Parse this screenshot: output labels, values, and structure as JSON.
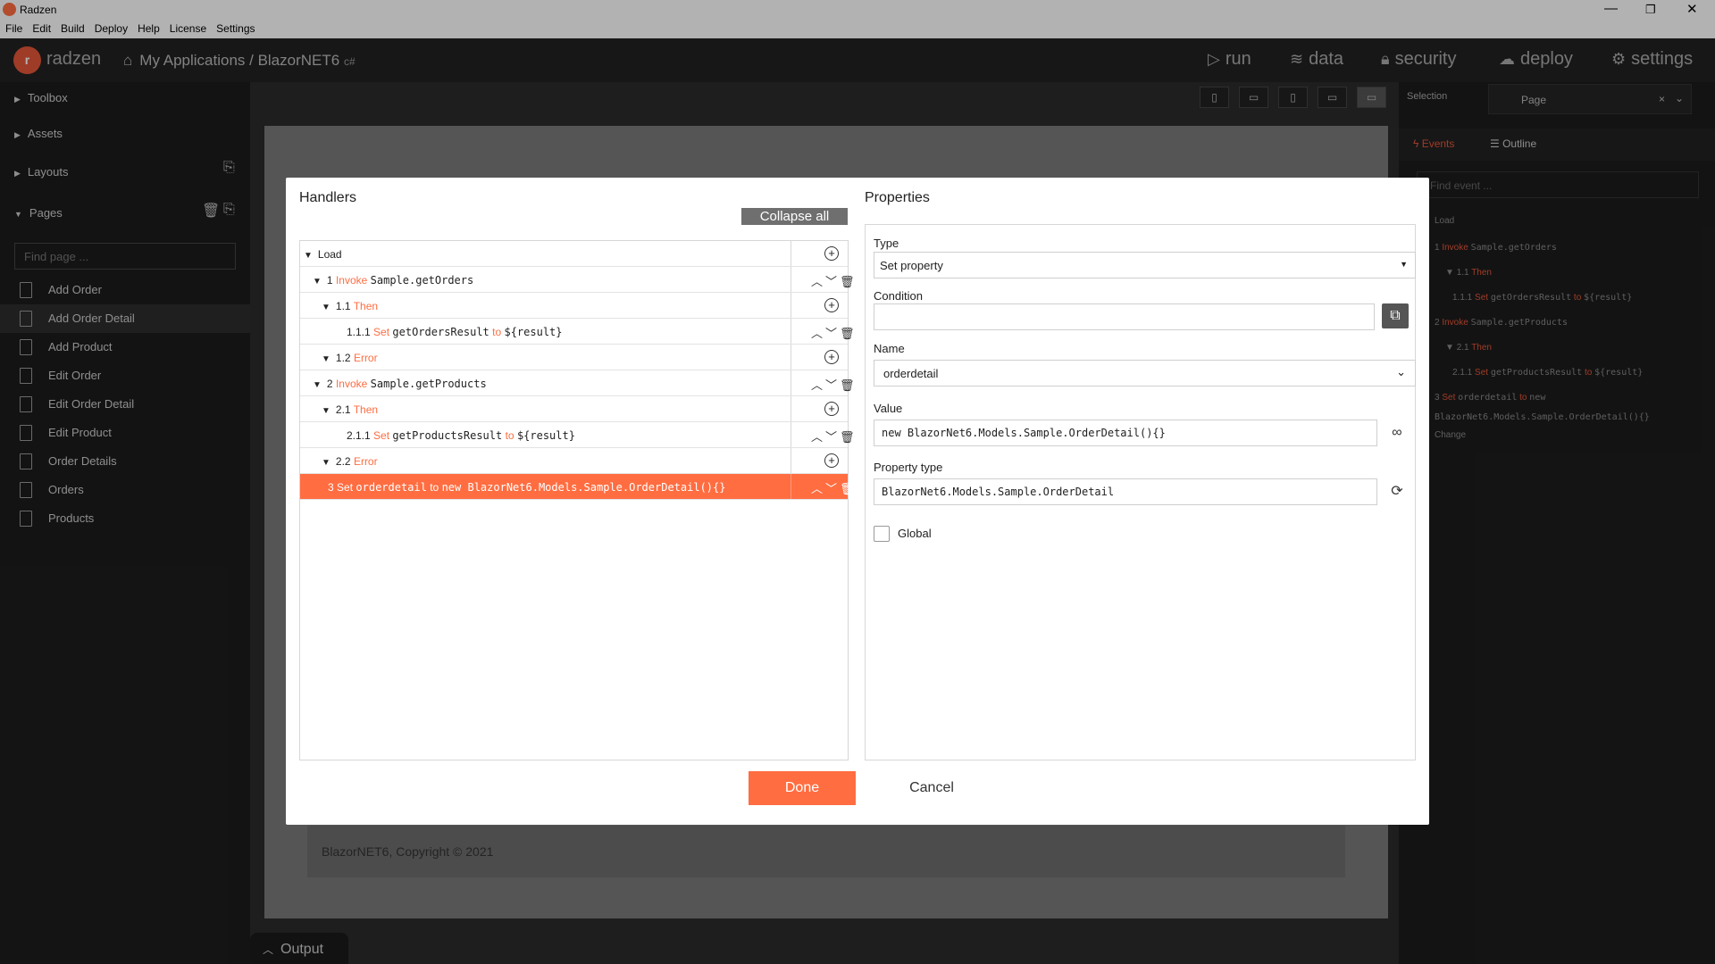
{
  "window": {
    "title": "Radzen"
  },
  "menu": [
    "File",
    "Edit",
    "Build",
    "Deploy",
    "Help",
    "License",
    "Settings"
  ],
  "appbar": {
    "brand": "radzen",
    "breadcrumb": "My Applications / BlazorNET6",
    "breadcrumb_suffix": "c#",
    "nav": [
      {
        "label": "run",
        "icon": "play-icon"
      },
      {
        "label": "data",
        "icon": "database-icon"
      },
      {
        "label": "security",
        "icon": "lock-icon"
      },
      {
        "label": "deploy",
        "icon": "cloud-icon"
      },
      {
        "label": "settings",
        "icon": "gear-icon"
      }
    ]
  },
  "sidebar": {
    "sections": [
      "Toolbox",
      "Assets",
      "Layouts",
      "Pages"
    ],
    "search_placeholder": "Find page ...",
    "pages": [
      "Add Order",
      "Add Order Detail",
      "Add Product",
      "Edit Order",
      "Edit Order Detail",
      "Edit Product",
      "Order Details",
      "Orders",
      "Products"
    ],
    "active_page": "Add Order Detail"
  },
  "canvas": {
    "footer": "BlazorNET6, Copyright © 2021",
    "output_tab": "Output"
  },
  "right_panel": {
    "selection_label": "Selection",
    "selection_value": "Page",
    "tabs": [
      "Events",
      "Outline"
    ],
    "find_placeholder": "Find event ...",
    "load_label": "Load",
    "change_label": "Change",
    "rows": [
      {
        "num": "1",
        "kw": "Invoke",
        "code": "Sample.getOrders"
      },
      {
        "num": "1.1",
        "kw": "Then",
        "code": ""
      },
      {
        "num": "1.1.1",
        "kw": "Set",
        "code": "getOrdersResult",
        "to": "to",
        "val": "${result}"
      },
      {
        "num": "2",
        "kw": "Invoke",
        "code": "Sample.getProducts"
      },
      {
        "num": "2.1",
        "kw": "Then",
        "code": ""
      },
      {
        "num": "2.1.1",
        "kw": "Set",
        "code": "getProductsResult",
        "to": "to",
        "val": "${result}"
      },
      {
        "num": "3",
        "kw": "Set",
        "code": "orderdetail",
        "to": "to",
        "val": "new"
      },
      {
        "num": "",
        "kw": "",
        "code": "BlazorNet6.Models.Sample.OrderDetail(){}"
      }
    ]
  },
  "dialog": {
    "handlers_title": "Handlers",
    "collapse_all": "Collapse all",
    "properties_title": "Properties",
    "tree": [
      {
        "num": "",
        "kw": "",
        "code": "",
        "label": "Load"
      },
      {
        "num": "1",
        "kw": "Invoke",
        "code": "Sample.getOrders"
      },
      {
        "num": "1.1",
        "kw": "Then",
        "code": ""
      },
      {
        "num": "1.1.1",
        "kw": "Set",
        "code": "getOrdersResult",
        "to": "to",
        "val": "${result}"
      },
      {
        "num": "1.2",
        "kw": "Error",
        "code": ""
      },
      {
        "num": "2",
        "kw": "Invoke",
        "code": "Sample.getProducts"
      },
      {
        "num": "2.1",
        "kw": "Then",
        "code": ""
      },
      {
        "num": "2.1.1",
        "kw": "Set",
        "code": "getProductsResult",
        "to": "to",
        "val": "${result}"
      },
      {
        "num": "2.2",
        "kw": "Error",
        "code": ""
      },
      {
        "num": "3",
        "kw": "Set",
        "code": "orderdetail",
        "to": "to",
        "val": "new BlazorNet6.Models.Sample.OrderDetail(){}"
      }
    ],
    "props": {
      "type_label": "Type",
      "type_value": "Set property",
      "condition_label": "Condition",
      "condition_value": "",
      "name_label": "Name",
      "name_value": "orderdetail",
      "value_label": "Value",
      "value_value": "new BlazorNet6.Models.Sample.OrderDetail(){}",
      "ptype_label": "Property type",
      "ptype_value": "BlazorNet6.Models.Sample.OrderDetail",
      "global_label": "Global"
    },
    "done": "Done",
    "cancel": "Cancel"
  }
}
